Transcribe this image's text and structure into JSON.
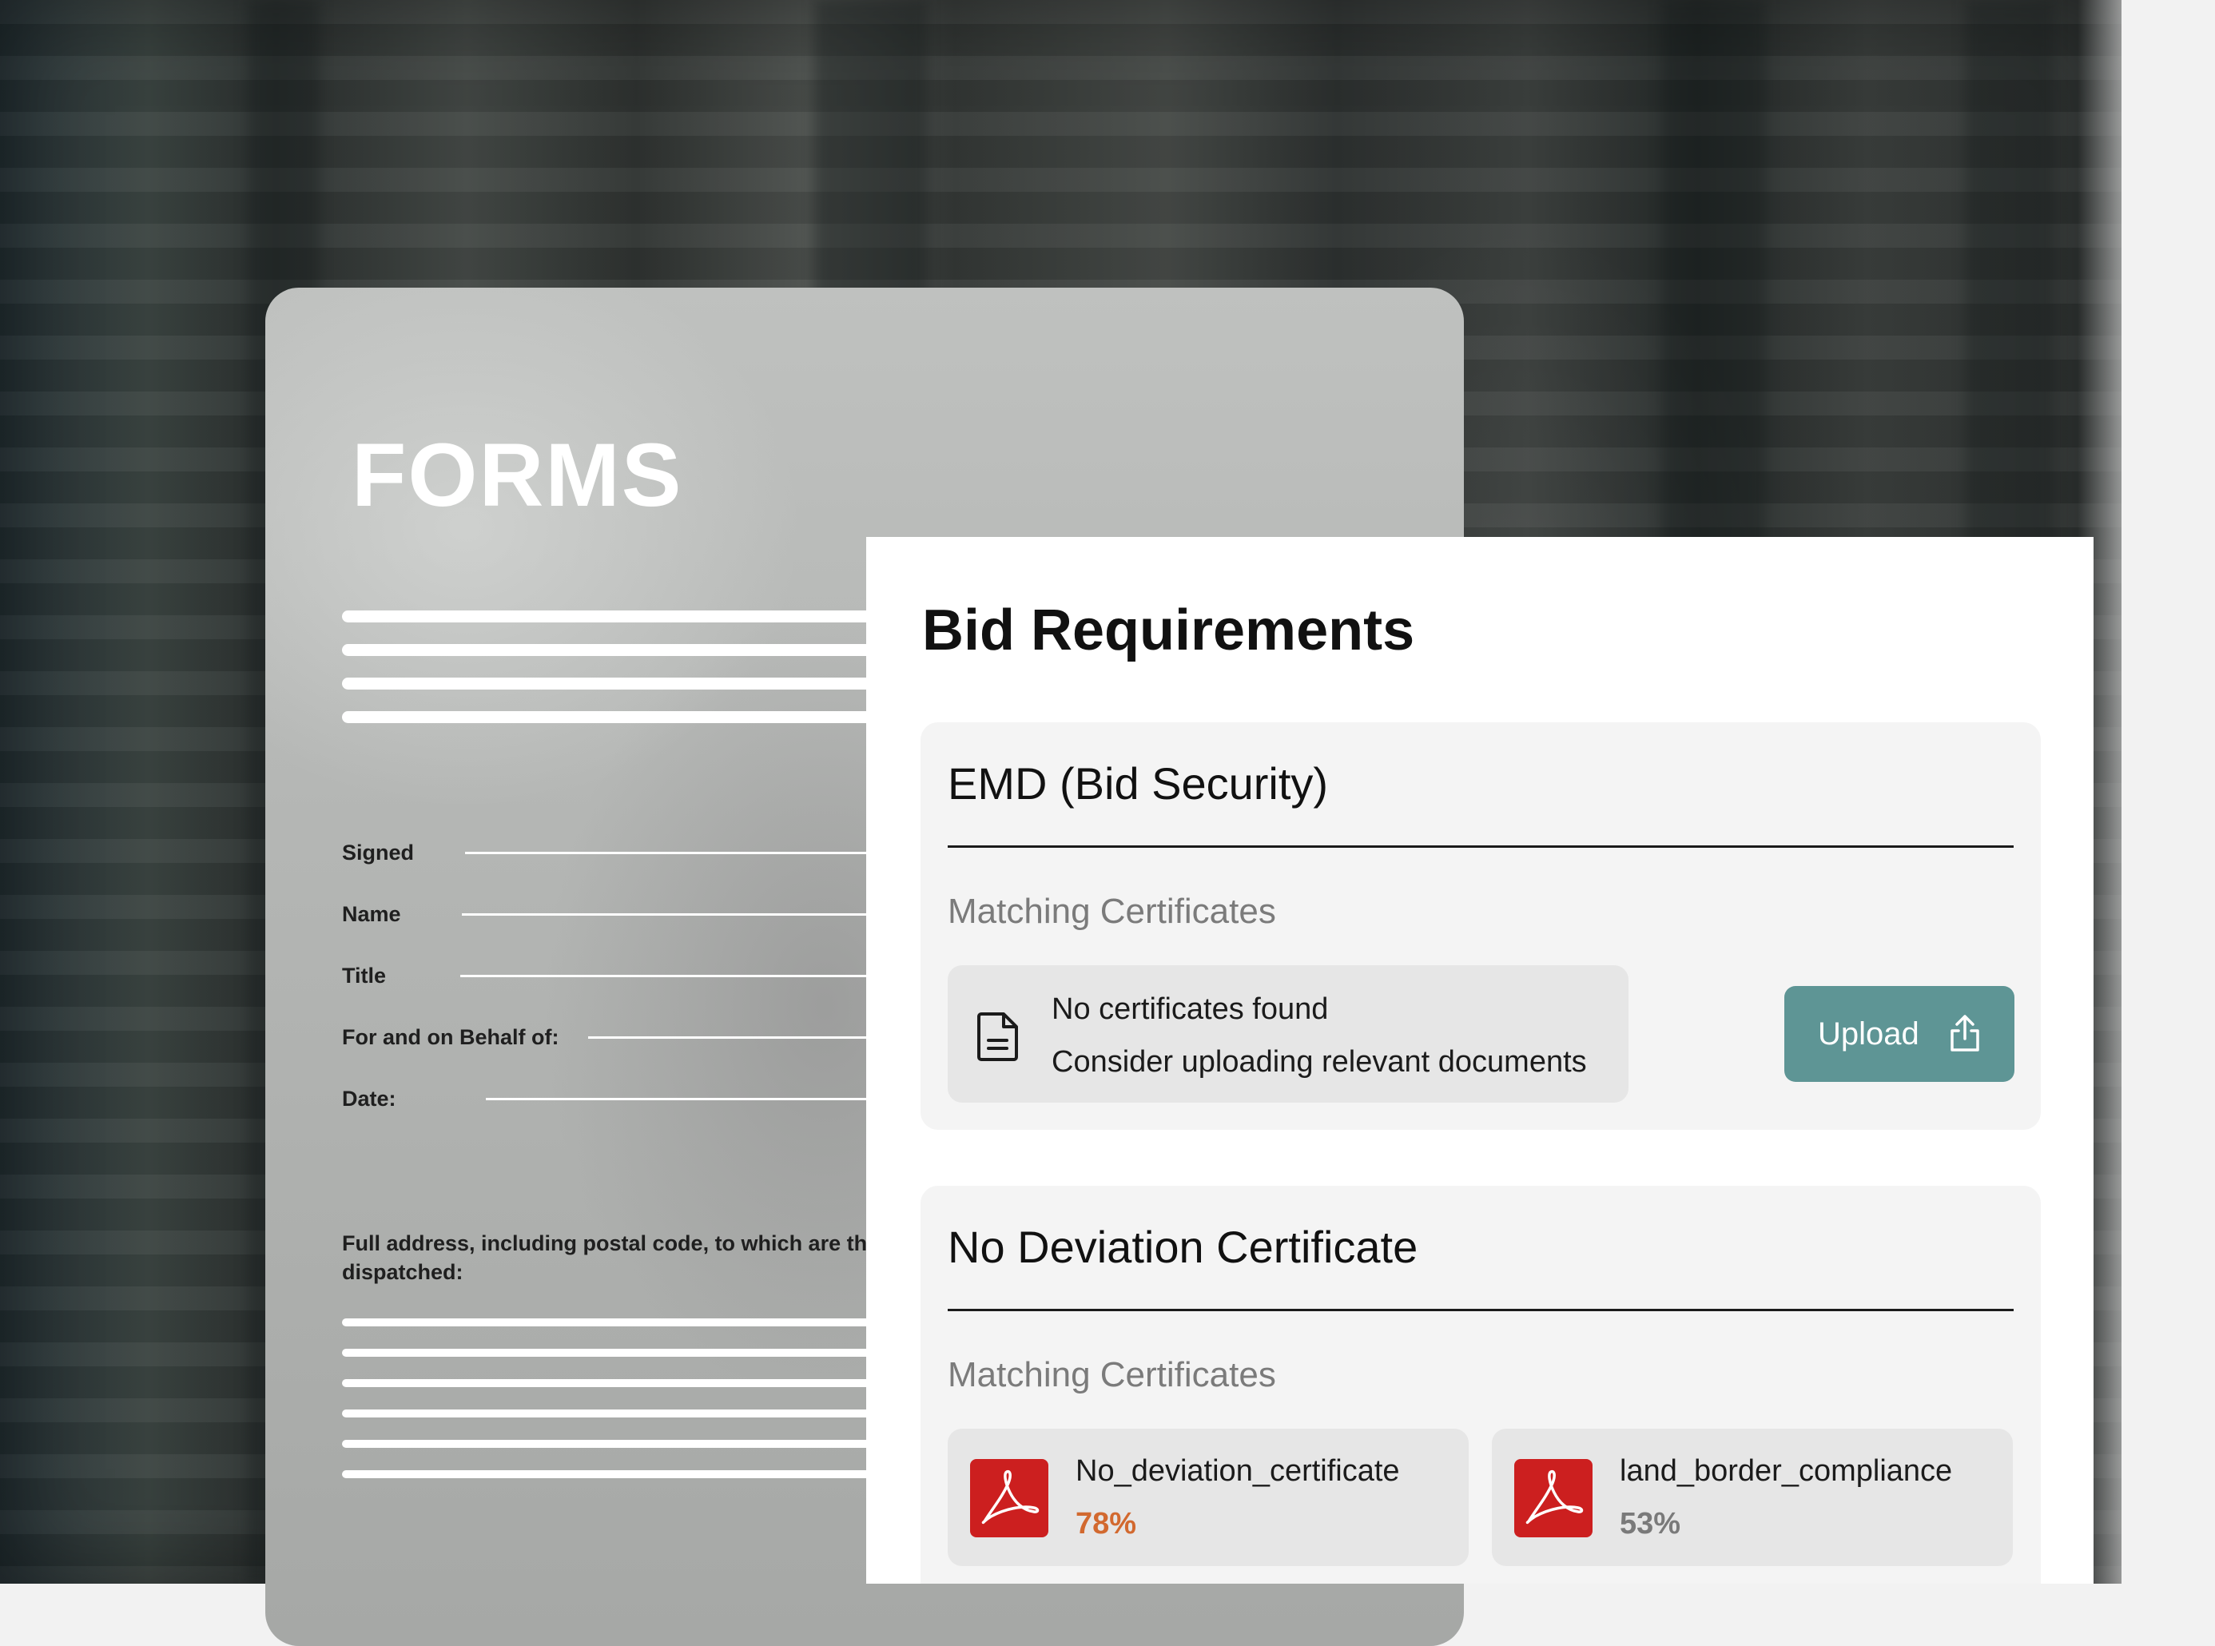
{
  "forms_card": {
    "title": "FORMS",
    "fields": [
      {
        "label": "Signed"
      },
      {
        "label": "Name"
      },
      {
        "label": "Title"
      },
      {
        "label": "For and on Behalf of:"
      },
      {
        "label": "Date:"
      }
    ],
    "address_label": "Full address, including postal code, to which are the dispatched:"
  },
  "bid_panel": {
    "title": "Bid Requirements",
    "requirements": [
      {
        "title": "EMD (Bid Security)",
        "subtitle": "Matching Certificates",
        "empty_state": {
          "icon": "document-icon",
          "line1": "No certificates found",
          "line2": "Consider uploading relevant documents"
        },
        "upload_button": {
          "label": "Upload",
          "icon": "upload-share-icon",
          "color": "#5e9595"
        }
      },
      {
        "title": "No Deviation Certificate",
        "subtitle": "Matching Certificates",
        "files": [
          {
            "name": "No_deviation_certificate",
            "match": "78%",
            "match_color": "#d2692f",
            "icon": "pdf-icon"
          },
          {
            "name": "land_border_compliance",
            "match": "53%",
            "match_color": "#7a7a7a",
            "icon": "pdf-icon"
          }
        ]
      }
    ]
  },
  "colors": {
    "accent_teal": "#5e9595",
    "pdf_red": "#cc1f1f"
  }
}
